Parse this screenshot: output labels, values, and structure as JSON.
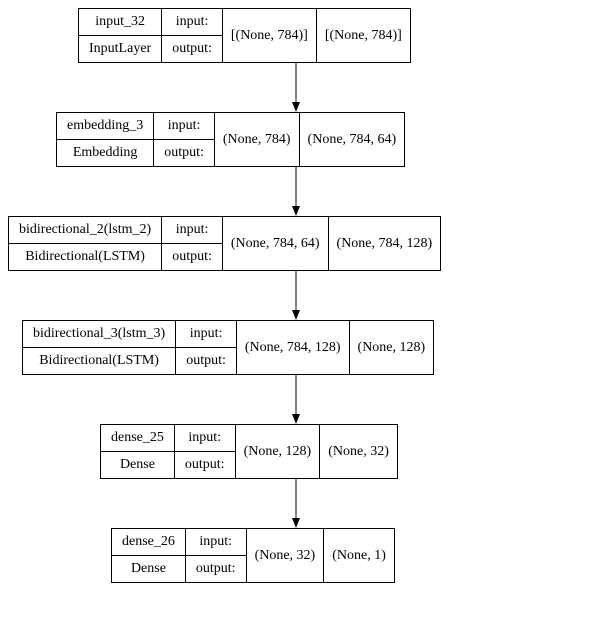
{
  "io_labels": {
    "input": "input:",
    "output": "output:"
  },
  "layers": [
    {
      "name": "input_32",
      "type": "InputLayer",
      "in_shape": "[(None, 784)]",
      "out_shape": "[(None, 784)]"
    },
    {
      "name": "embedding_3",
      "type": "Embedding",
      "in_shape": "(None, 784)",
      "out_shape": "(None, 784, 64)"
    },
    {
      "name": "bidirectional_2(lstm_2)",
      "type": "Bidirectional(LSTM)",
      "in_shape": "(None, 784, 64)",
      "out_shape": "(None, 784, 128)"
    },
    {
      "name": "bidirectional_3(lstm_3)",
      "type": "Bidirectional(LSTM)",
      "in_shape": "(None, 784, 128)",
      "out_shape": "(None, 128)"
    },
    {
      "name": "dense_25",
      "type": "Dense",
      "in_shape": "(None, 128)",
      "out_shape": "(None, 32)"
    },
    {
      "name": "dense_26",
      "type": "Dense",
      "in_shape": "(None, 32)",
      "out_shape": "(None, 1)"
    }
  ]
}
